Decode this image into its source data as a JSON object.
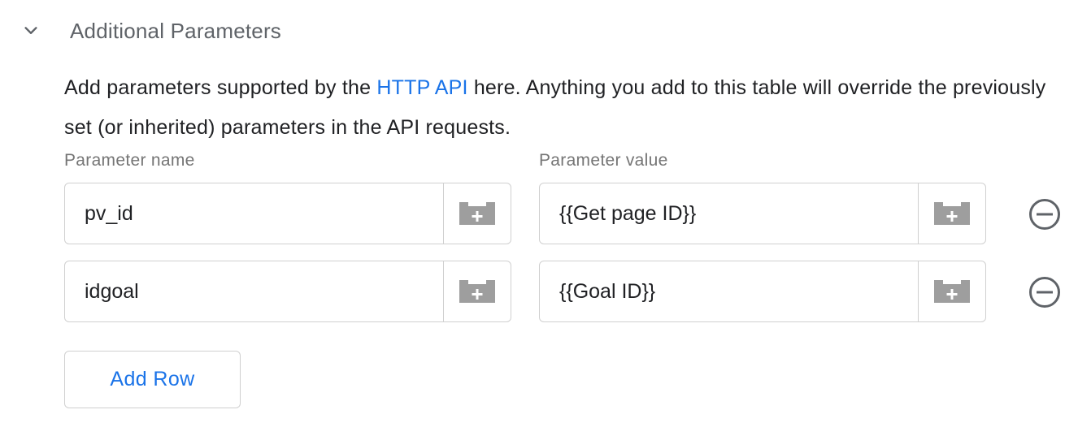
{
  "section": {
    "title": "Additional Parameters",
    "expanded": true
  },
  "description": {
    "before_link": "Add parameters supported by the ",
    "link_text": "HTTP API",
    "after_link": " here. Anything you add to this table will override the previously set (or inherited) parameters in the API requests."
  },
  "table": {
    "name_header": "Parameter name",
    "value_header": "Parameter value",
    "rows": [
      {
        "name": "pv_id",
        "value": "{{Get page ID}}"
      },
      {
        "name": "idgoal",
        "value": "{{Goal ID}}"
      }
    ]
  },
  "add_row_label": "Add Row",
  "icons": {
    "collapse": "chevron-down-icon",
    "variable": "variable-picker-icon",
    "remove": "remove-circle-icon"
  },
  "colors": {
    "link": "#1a73e8",
    "icon": "#9e9e9e",
    "border": "#d0d0d0"
  }
}
